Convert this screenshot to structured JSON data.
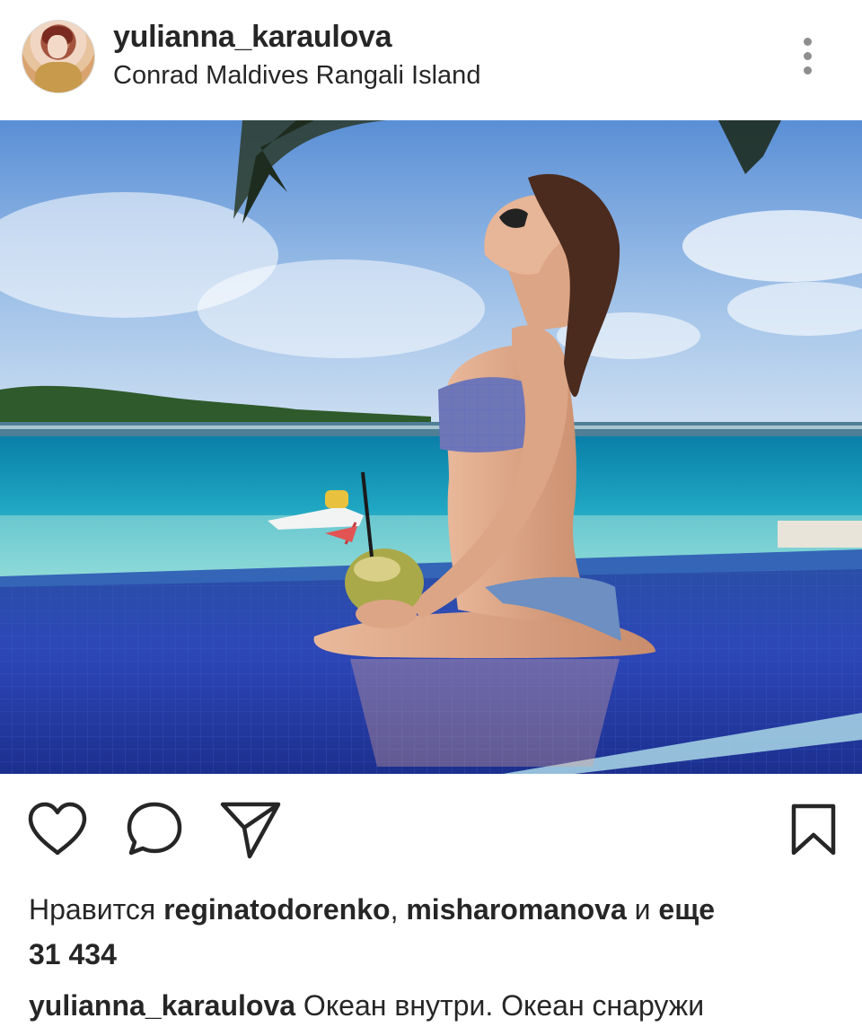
{
  "post": {
    "username": "yulianna_karaulova",
    "location": "Conrad Maldives Rangali Island"
  },
  "actions": {
    "like_icon": "heart-icon",
    "comment_icon": "comment-bubble-icon",
    "share_icon": "paper-plane-icon",
    "save_icon": "bookmark-icon",
    "more_icon": "vertical-dots-icon"
  },
  "likes": {
    "prefix": "Нравится",
    "user1": "reginatodorenko",
    "separator": ",",
    "user2": "misharomanova",
    "and": "и",
    "more_label": "еще",
    "count": "31 434"
  },
  "caption": {
    "username": "yulianna_karaulova",
    "text": "Океан внутри. Океан снаружи"
  },
  "colors": {
    "text": "#262626",
    "secondary": "#8e8e8e"
  }
}
